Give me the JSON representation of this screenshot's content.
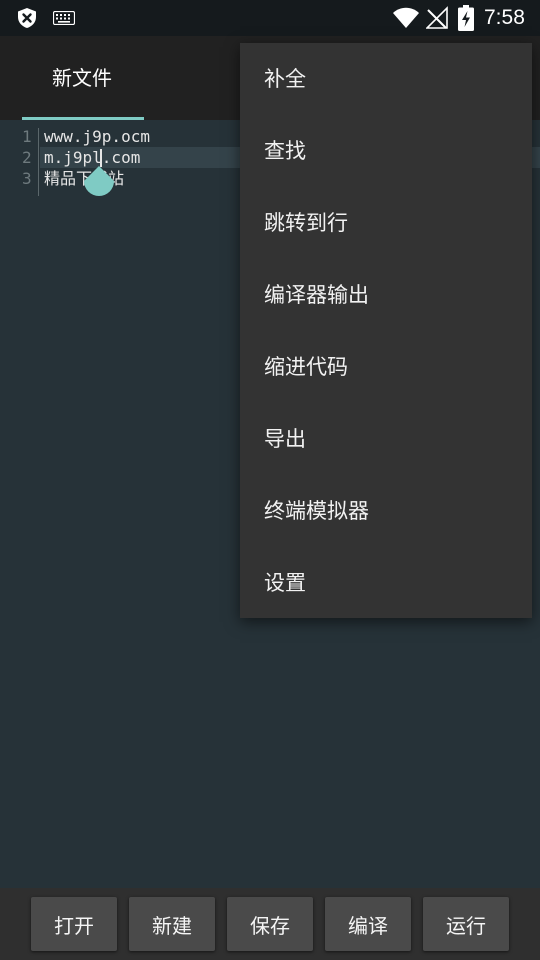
{
  "status_bar": {
    "time": "7:58",
    "icons": [
      "shield-close-icon",
      "keyboard-icon",
      "wifi-icon",
      "no-signal-icon",
      "battery-charging-icon"
    ]
  },
  "tab": {
    "label": "新文件"
  },
  "editor": {
    "lines": [
      {
        "num": "1",
        "text": "www.j9p.ocm"
      },
      {
        "num": "2",
        "text": "m.j9pl.com"
      },
      {
        "num": "3",
        "text": "精品下载站"
      }
    ]
  },
  "menu": {
    "items": [
      "补全",
      "查找",
      "跳转到行",
      "编译器输出",
      "缩进代码",
      "导出",
      "终端模拟器",
      "设置"
    ]
  },
  "bottom_bar": {
    "buttons": [
      "打开",
      "新建",
      "保存",
      "编译",
      "运行"
    ]
  },
  "colors": {
    "editor_bg": "#263238",
    "accent": "#7fcbc4",
    "menu_bg": "#333333",
    "app_bar_bg": "#212121"
  }
}
